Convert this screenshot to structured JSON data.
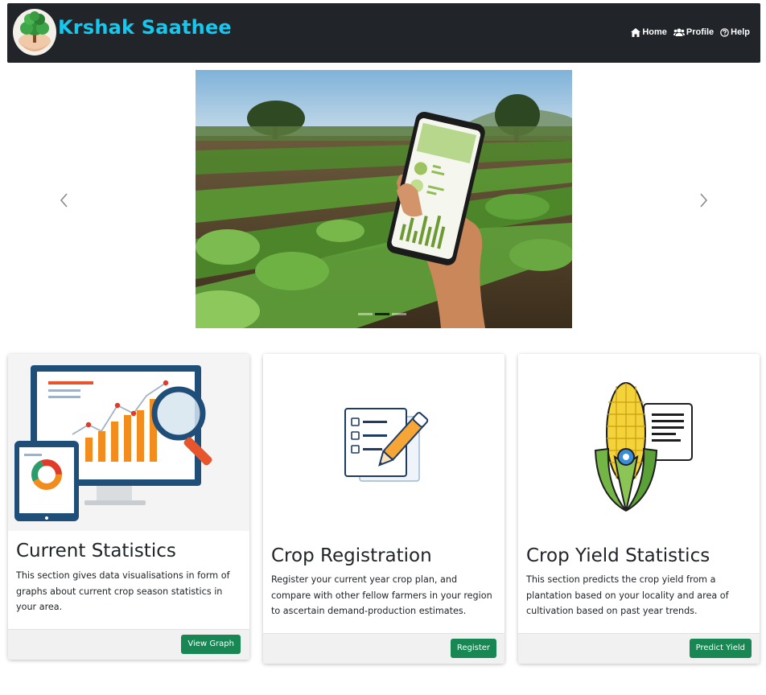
{
  "brand": {
    "name": "Krshak Saathee"
  },
  "nav": {
    "home": "Home",
    "profile": "Profile",
    "help": "Help"
  },
  "carousel": {
    "prev_icon": "chevron-left-icon",
    "next_icon": "chevron-right-icon",
    "slide_count": 3,
    "active_slide": 2
  },
  "cards": [
    {
      "title": "Current Statistics",
      "text": "This section gives data visualisations in form of graphs about current crop season statistics in your area.",
      "button": "View Graph"
    },
    {
      "title": "Crop Registration",
      "text": "Register your current year crop plan, and compare with other fellow farmers in your region to ascertain demand-production estimates.",
      "button": "Register"
    },
    {
      "title": "Crop Yield Statistics",
      "text": "This section predicts the crop yield from a plantation based on your locality and area of cultivation based on past year trends.",
      "button": "Predict Yield"
    }
  ],
  "colors": {
    "navbar": "#212529",
    "brand": "#14c8f0",
    "button": "#198754"
  }
}
